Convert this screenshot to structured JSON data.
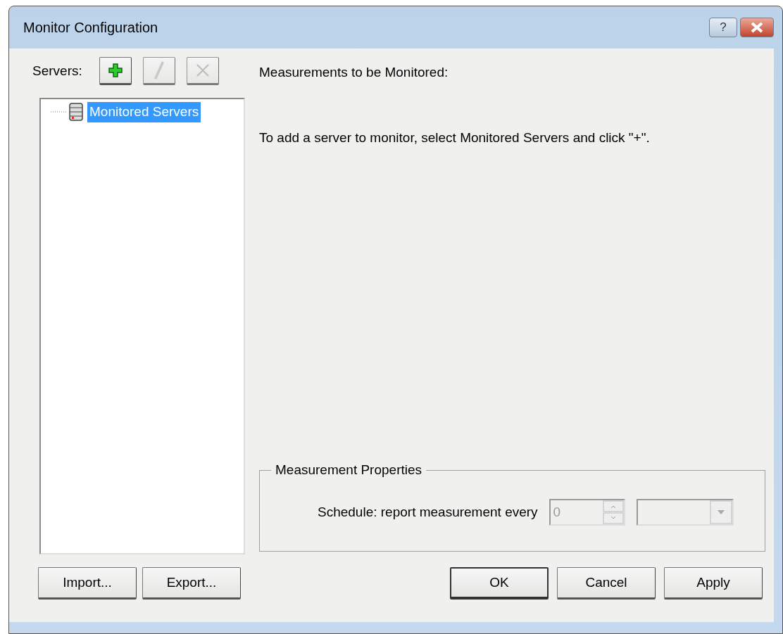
{
  "window": {
    "title": "Monitor Configuration",
    "help_button": "?"
  },
  "servers": {
    "label": "Servers:",
    "tools": [
      {
        "kind": "add",
        "disabled": false
      },
      {
        "kind": "edit",
        "disabled": true
      },
      {
        "kind": "delete",
        "disabled": true
      }
    ],
    "tree": [
      {
        "label": "Monitored Servers",
        "selected": true
      }
    ]
  },
  "measurements": {
    "label": "Measurements to be Monitored:",
    "hint": "To add a server to monitor, select Monitored Servers and click \"+\"."
  },
  "properties": {
    "title": "Measurement Properties",
    "schedule_label": "Schedule: report measurement every",
    "interval": {
      "value": "0",
      "disabled": true
    },
    "unit": {
      "disabled": true
    }
  },
  "left_buttons": [
    {
      "label": "Import...",
      "default": false
    },
    {
      "label": "Export...",
      "default": false
    }
  ],
  "right_buttons": [
    {
      "label": "OK",
      "default": true
    },
    {
      "label": "Cancel",
      "default": false
    },
    {
      "label": "Apply",
      "default": false
    }
  ]
}
